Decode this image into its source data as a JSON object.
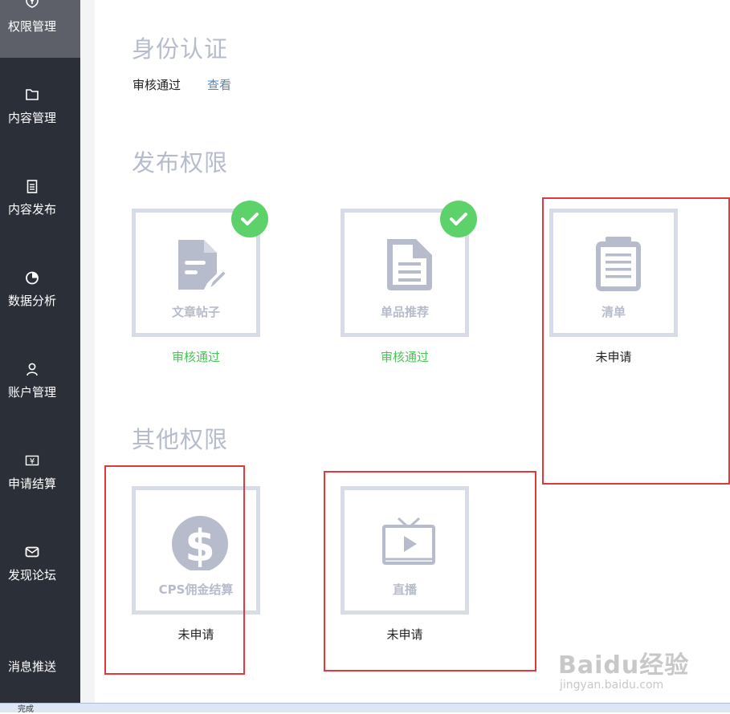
{
  "sidebar": {
    "items": [
      {
        "label": "权限管理",
        "icon": "shield-key-icon",
        "active": true
      },
      {
        "label": "内容管理",
        "icon": "folder-icon"
      },
      {
        "label": "内容发布",
        "icon": "clipboard-icon"
      },
      {
        "label": "数据分析",
        "icon": "pie-chart-icon"
      },
      {
        "label": "账户管理",
        "icon": "user-icon"
      },
      {
        "label": "申请结算",
        "icon": "yen-ticket-icon"
      },
      {
        "label": "发现论坛",
        "icon": "envelope-icon"
      },
      {
        "label": "消息推送",
        "icon": ""
      }
    ]
  },
  "identity": {
    "title": "身份认证",
    "status": "审核通过",
    "view_link": "查看"
  },
  "publish": {
    "title": "发布权限",
    "cards": [
      {
        "label": "文章帖子",
        "icon": "document-edit-icon",
        "status": "审核通过",
        "approved": true
      },
      {
        "label": "单品推荐",
        "icon": "document-lines-icon",
        "status": "审核通过",
        "approved": true
      },
      {
        "label": "清单",
        "icon": "list-clipboard-icon",
        "status": "未申请",
        "approved": false
      }
    ]
  },
  "other": {
    "title": "其他权限",
    "cards": [
      {
        "label": "CPS佣金结算",
        "icon": "dollar-coin-icon",
        "status": "未申请",
        "approved": false
      },
      {
        "label": "直播",
        "icon": "tv-play-icon",
        "status": "未申请",
        "approved": false
      }
    ]
  },
  "statusbar": {
    "text": "完成"
  },
  "watermark": {
    "text": "Baidu经验",
    "url": "jingyan.baidu.com"
  },
  "colors": {
    "sidebar_bg": "#2b2f38",
    "sidebar_active": "#5d6068",
    "approved_green": "#4cc25a",
    "check_green": "#5dd16a",
    "link_blue": "#3b8fd8",
    "highlight_red": "#e3383b",
    "icon_gray": "#b6bccb"
  }
}
